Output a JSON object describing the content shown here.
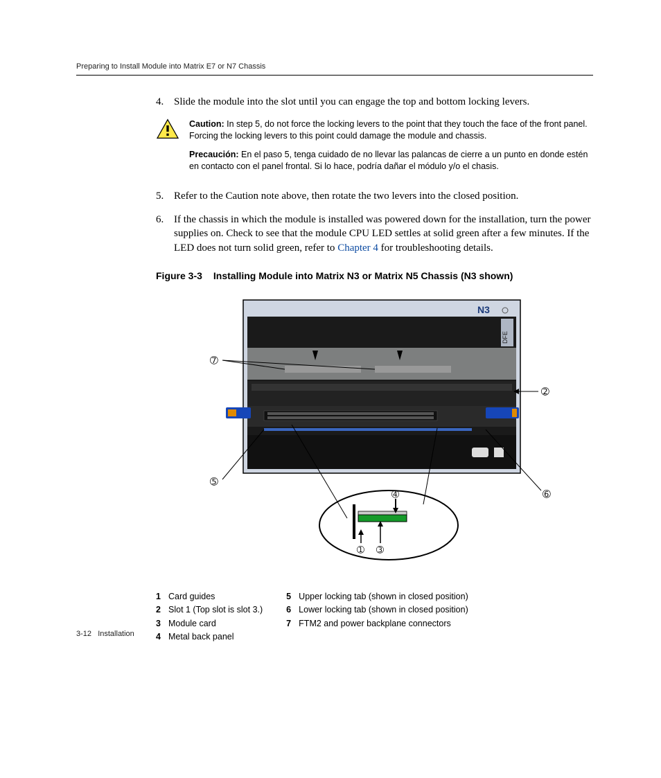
{
  "header": {
    "running_head": "Preparing to Install Module into Matrix E7 or N7 Chassis"
  },
  "steps": {
    "s4": {
      "num": "4.",
      "text": "Slide the module into the slot until you can engage the top and bottom locking levers."
    },
    "s5": {
      "num": "5.",
      "text": "Refer to the Caution note above, then rotate the two levers into the closed position."
    },
    "s6": {
      "num": "6.",
      "text_a": "If the chassis in which the module is installed was powered down for the installation, turn the power supplies on. Check to see that the module CPU LED settles at solid green after a few minutes. If the LED does not turn solid green, refer to ",
      "link": "Chapter 4",
      "text_b": " for troubleshooting details."
    }
  },
  "caution": {
    "en_label": "Caution:",
    "en_text": " In step 5, do not force the locking levers to the point that they touch the face of the front panel. Forcing the locking levers to this point could damage the module and chassis.",
    "es_label": "Precaución:",
    "es_text": " En el paso 5, tenga cuidado de no llevar las palancas de cierre a un punto en donde estén en contacto con el panel frontal. Si lo hace, podría dañar el módulo y/o el chasis."
  },
  "figure": {
    "num": "Figure 3-3",
    "title": "Installing Module into Matrix N3 or Matrix N5 Chassis (N3 shown)",
    "device_label": "N3",
    "module_label": "DFE",
    "callouts": {
      "c1": "➀",
      "c2": "➁",
      "c3": "➂",
      "c4": "➃",
      "c5": "➄",
      "c6": "➅",
      "c7": "➆"
    }
  },
  "legend": {
    "left": {
      "r1": {
        "k": "1",
        "v": "Card guides"
      },
      "r2": {
        "k": "2",
        "v": "Slot 1 (Top slot is slot 3.)"
      },
      "r3": {
        "k": "3",
        "v": "Module card"
      },
      "r4": {
        "k": "4",
        "v": "Metal back panel"
      }
    },
    "right": {
      "r1": {
        "k": "5",
        "v": "Upper locking tab (shown in closed position)"
      },
      "r2": {
        "k": "6",
        "v": "Lower locking tab (shown in closed position)"
      },
      "r3": {
        "k": "7",
        "v": "FTM2 and power backplane connectors"
      }
    }
  },
  "footer": {
    "page": "3-12",
    "section": "Installation"
  }
}
